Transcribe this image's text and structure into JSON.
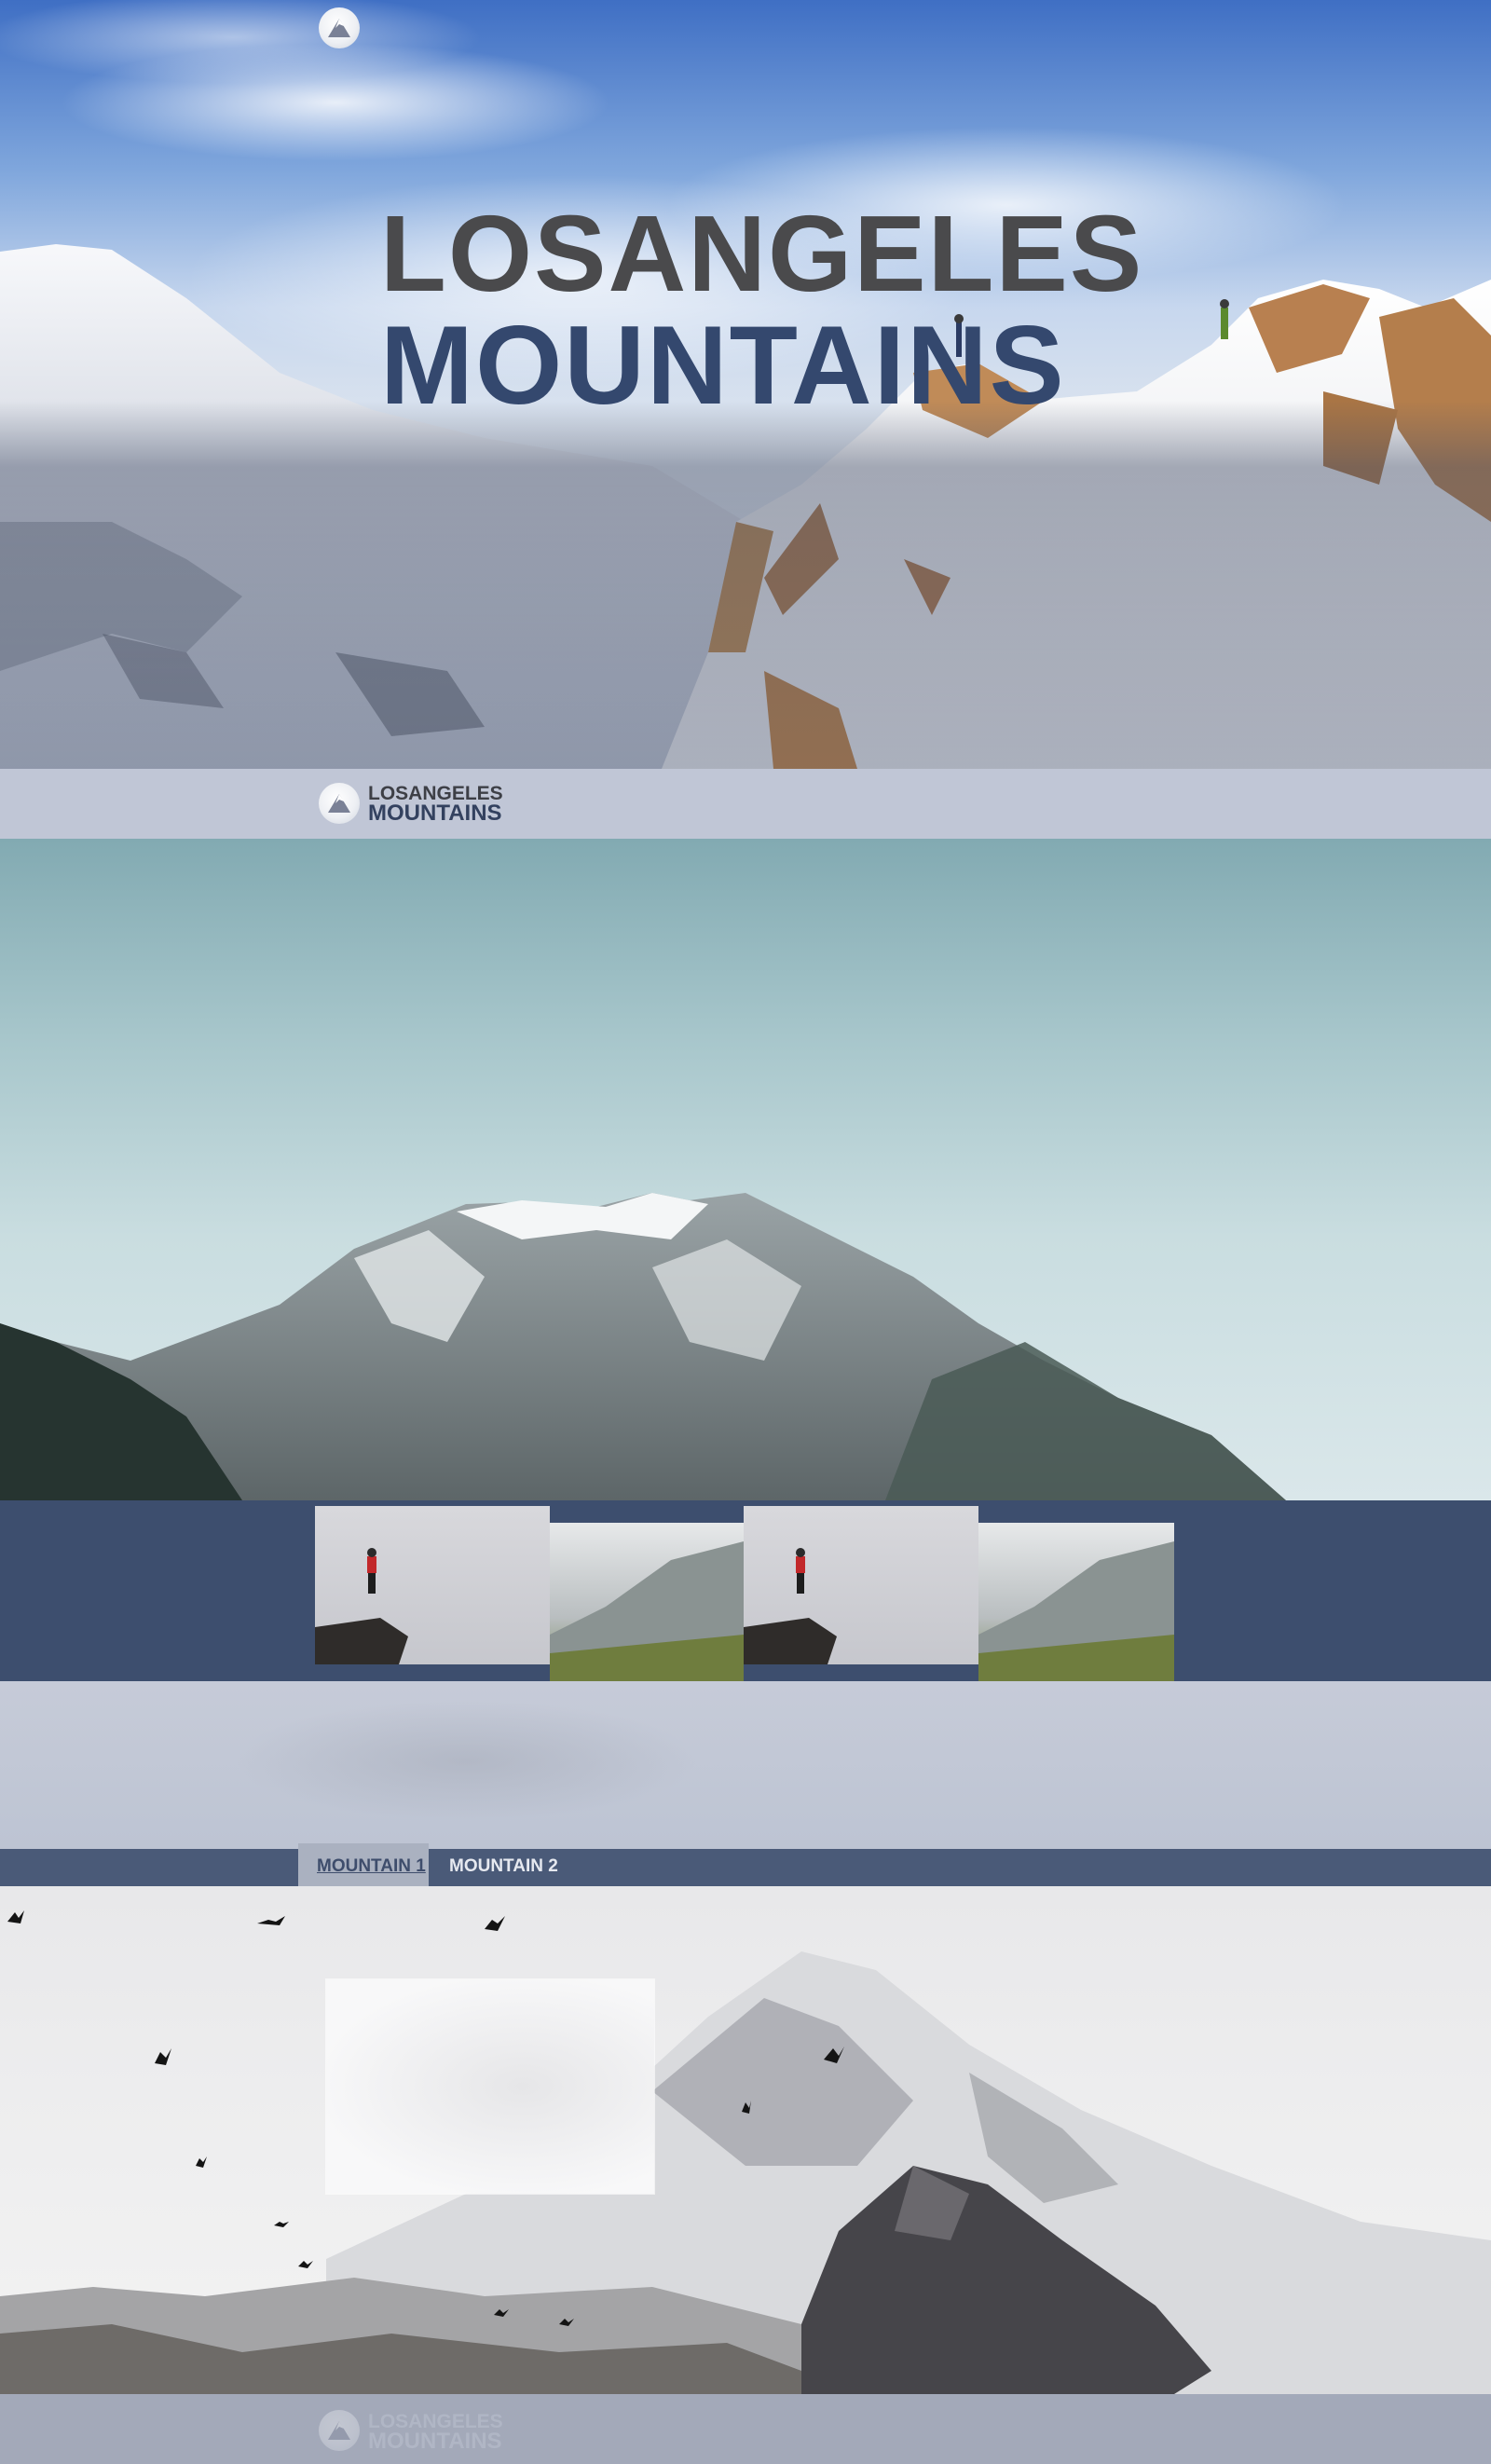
{
  "brand": {
    "line1": "LOSANGELES",
    "line2": "MOUNTAINS"
  },
  "hero": {
    "title_line1": "LOSANGELES",
    "title_line2": "MOUNTAINS",
    "logo_icon": "mountain-peak-icon"
  },
  "navbar": {
    "logo_line1": "LOSANGELES",
    "logo_line2": "MOUNTAINS"
  },
  "tabs": [
    {
      "label": "MOUNTAIN 1",
      "active": true
    },
    {
      "label": "MOUNTAIN 2",
      "active": false
    }
  ],
  "footer": {
    "logo_line1": "LOSANGELES",
    "logo_line2": "MOUNTAINS"
  },
  "colors": {
    "navy": "#3d4e6e",
    "tab_bar": "#4a5a78",
    "nav_bg": "#c0c6d6",
    "title_gray": "#4a4a4c",
    "title_blue": "#34486e"
  }
}
